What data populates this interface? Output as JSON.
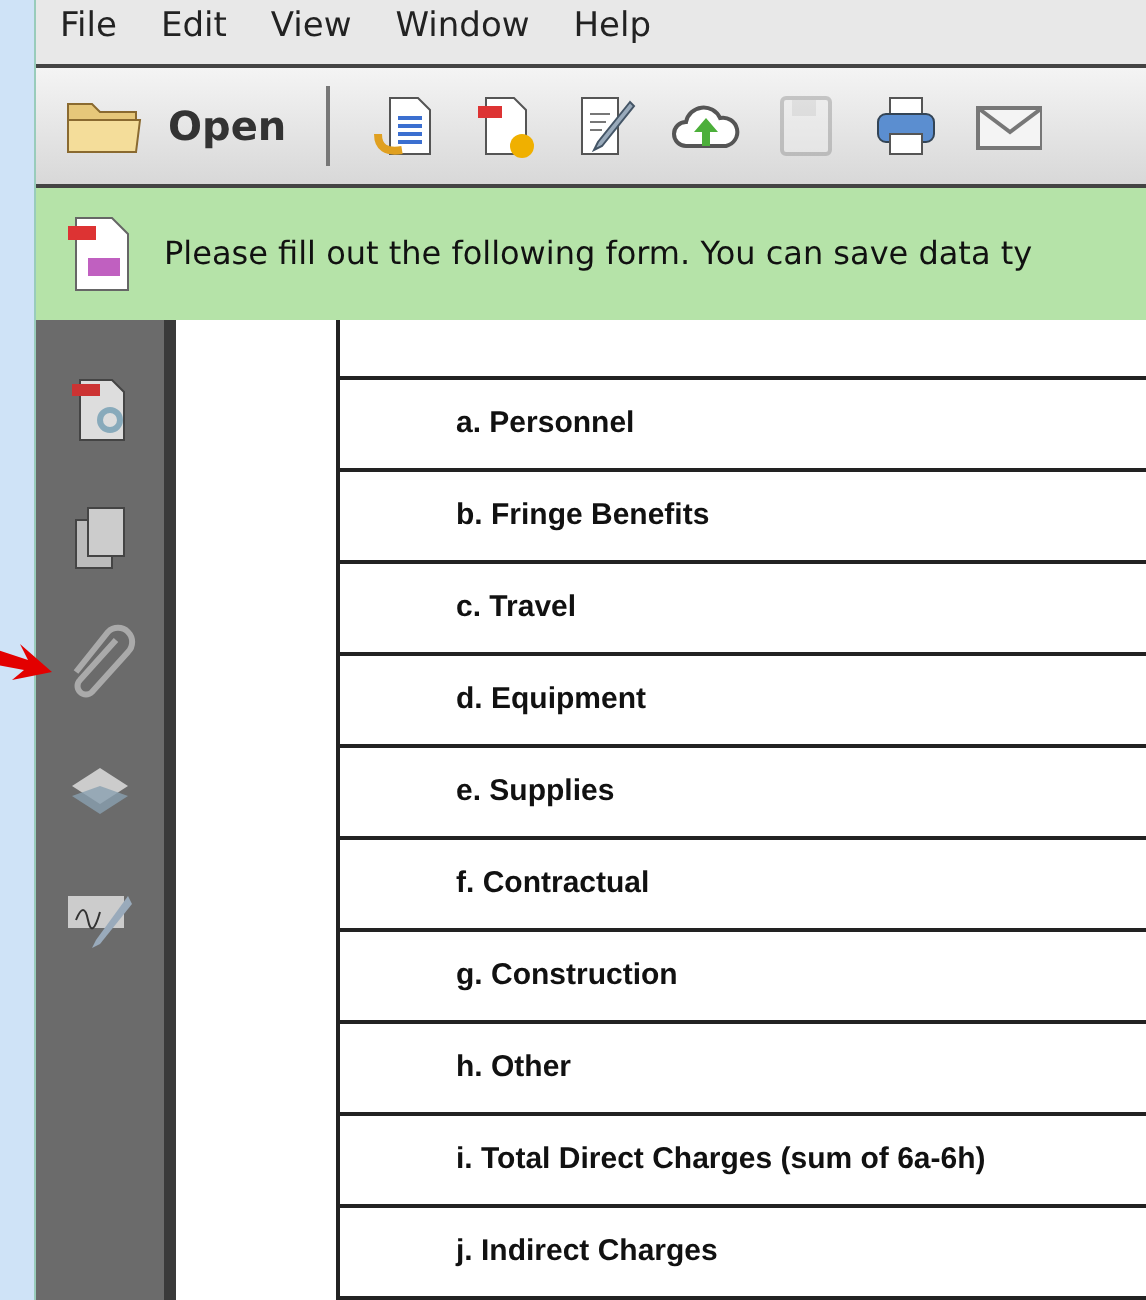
{
  "menu": [
    "File",
    "Edit",
    "View",
    "Window",
    "Help"
  ],
  "toolbar": {
    "open_label": "Open",
    "tools": [
      {
        "kind": "convert"
      },
      {
        "kind": "form"
      },
      {
        "kind": "edit"
      },
      {
        "kind": "cloud"
      },
      {
        "kind": "save",
        "disabled": true
      },
      {
        "kind": "print",
        "disabled": false
      },
      {
        "kind": "mail",
        "disabled": false
      }
    ]
  },
  "notice": {
    "text": "Please fill out the following form. You can save data ty"
  },
  "sidebar": {
    "items": [
      {
        "kind": "search-doc"
      },
      {
        "kind": "pages"
      },
      {
        "kind": "attach",
        "highlighted": true
      },
      {
        "kind": "layers"
      },
      {
        "kind": "sign"
      }
    ]
  },
  "form": {
    "rows": [
      "a. Personnel",
      "b. Fringe Benefits",
      "c. Travel",
      "d. Equipment",
      "e. Supplies",
      "f. Contractual",
      "g. Construction",
      "h. Other",
      "i. Total Direct Charges (sum of 6a-6h)",
      "j. Indirect Charges"
    ]
  }
}
